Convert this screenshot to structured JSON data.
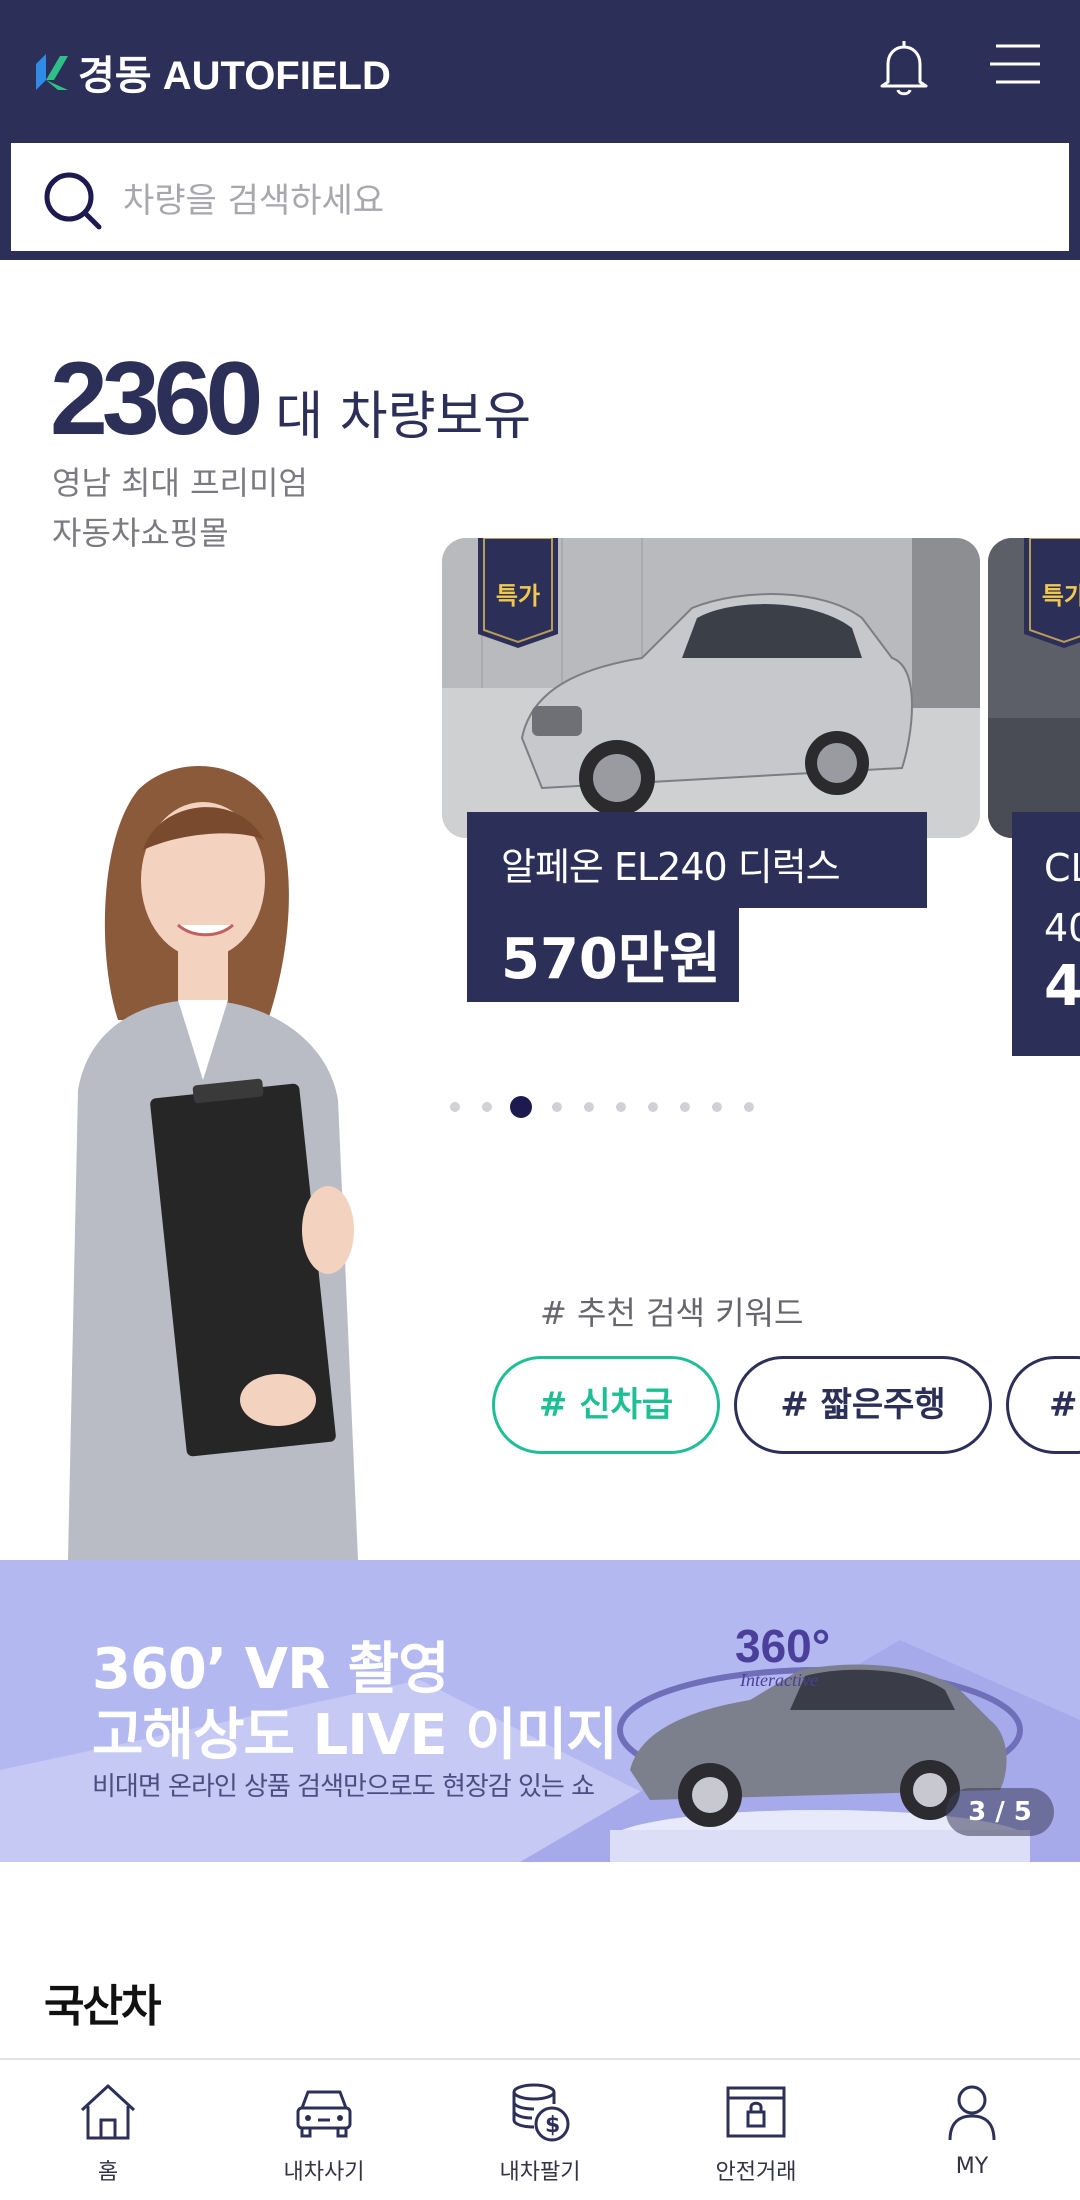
{
  "header": {
    "logo_text": "경동 AUTOFIELD",
    "search_placeholder": "차량을 검색하세요"
  },
  "hero": {
    "count": "2360",
    "count_unit": "대 차량보유",
    "tagline_line1": "영남 최대 프리미엄",
    "tagline_line2": "자동차쇼핑몰"
  },
  "cars": [
    {
      "badge": "특가",
      "name": "알페온 EL240 디럭스",
      "price": "570만원"
    },
    {
      "badge": "특가",
      "name_partial": "CL\n40",
      "price_partial": "4"
    }
  ],
  "carousel": {
    "dot_count": 10,
    "active_index": 2
  },
  "keywords": {
    "title": "# 추천 검색 키워드",
    "chips": [
      "# 신차급",
      "# 짧은주행",
      "#"
    ]
  },
  "banner": {
    "line1": "360’ VR 촬영",
    "line2": "고해상도 LIVE 이미지",
    "sub": "비대면 온라인 상품 검색만으로도 현장감 있는 쇼",
    "badge_360": "360°",
    "badge_interactive": "Interactive",
    "counter": "3 / 5"
  },
  "section": {
    "title": "국산차"
  },
  "tabbar": {
    "items": [
      {
        "label": "홈",
        "icon": "home-icon"
      },
      {
        "label": "내차사기",
        "icon": "car-icon"
      },
      {
        "label": "내차팔기",
        "icon": "coins-icon"
      },
      {
        "label": "안전거래",
        "icon": "safe-lock-icon"
      },
      {
        "label": "MY",
        "icon": "user-icon"
      }
    ]
  },
  "colors": {
    "navy": "#2c3059",
    "accent_green": "#1fbf95",
    "badge_gold": "#f2c94c",
    "banner_bg": "#b4b8f0"
  }
}
